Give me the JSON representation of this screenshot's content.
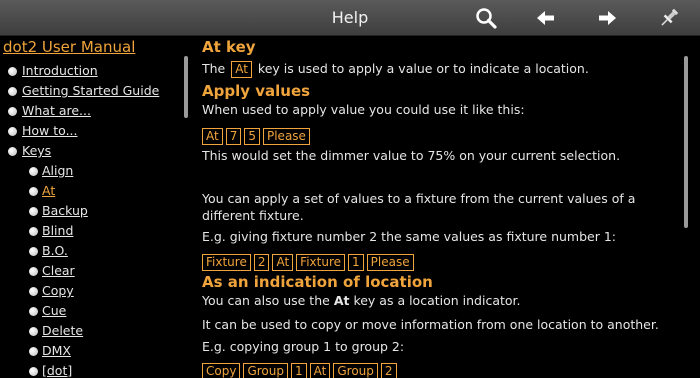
{
  "titlebar": {
    "title": "Help",
    "icons": [
      "search-icon",
      "back-arrow-icon",
      "forward-arrow-icon",
      "pin-icon"
    ]
  },
  "sidebar": {
    "title": "dot2 User Manual",
    "items": [
      {
        "label": "Introduction",
        "level": 0
      },
      {
        "label": "Getting Started Guide",
        "level": 0
      },
      {
        "label": "What are...",
        "level": 0
      },
      {
        "label": "How to...",
        "level": 0
      },
      {
        "label": "Keys",
        "level": 0
      },
      {
        "label": "Align",
        "level": 1
      },
      {
        "label": "At",
        "level": 1,
        "active": true
      },
      {
        "label": "Backup",
        "level": 1
      },
      {
        "label": "Blind",
        "level": 1
      },
      {
        "label": "B.O.",
        "level": 1
      },
      {
        "label": "Clear",
        "level": 1
      },
      {
        "label": "Copy",
        "level": 1
      },
      {
        "label": "Cue",
        "level": 1
      },
      {
        "label": "Delete",
        "level": 1
      },
      {
        "label": "DMX",
        "level": 1
      },
      {
        "label": "[dot]",
        "level": 1
      }
    ]
  },
  "content": {
    "h_at_key": "At key",
    "intro_before": "The",
    "intro_key": "At",
    "intro_after": "key is used to apply a value or to indicate a location.",
    "h_apply": "Apply values",
    "apply_text": "When used to apply value you could use it like this:",
    "keys1": [
      "At",
      "7",
      "5",
      "Please"
    ],
    "dimmer_text": "This would set the dimmer value to 75% on your current selection.",
    "set_values_text": "You can apply a set of values to a fixture from the current values of a different fixture.",
    "eg1_text": "E.g. giving fixture number 2 the same values as fixture number 1:",
    "keys2": [
      "Fixture",
      "2",
      "At",
      "Fixture",
      "1",
      "Please"
    ],
    "h_location": "As an indication of location",
    "loc_before": "You can also use the",
    "loc_bold": "At",
    "loc_after": "key as a location indicator.",
    "copy_move_text": "It can be used to copy or move information from one location to another.",
    "eg2_text": "E.g. copying group 1 to group 2:",
    "keys3": [
      "Copy",
      "Group",
      "1",
      "At",
      "Group",
      "2"
    ]
  },
  "colors": {
    "accent": "#f0a43c",
    "background": "#000000",
    "titlebar": "#4a4a4a"
  }
}
